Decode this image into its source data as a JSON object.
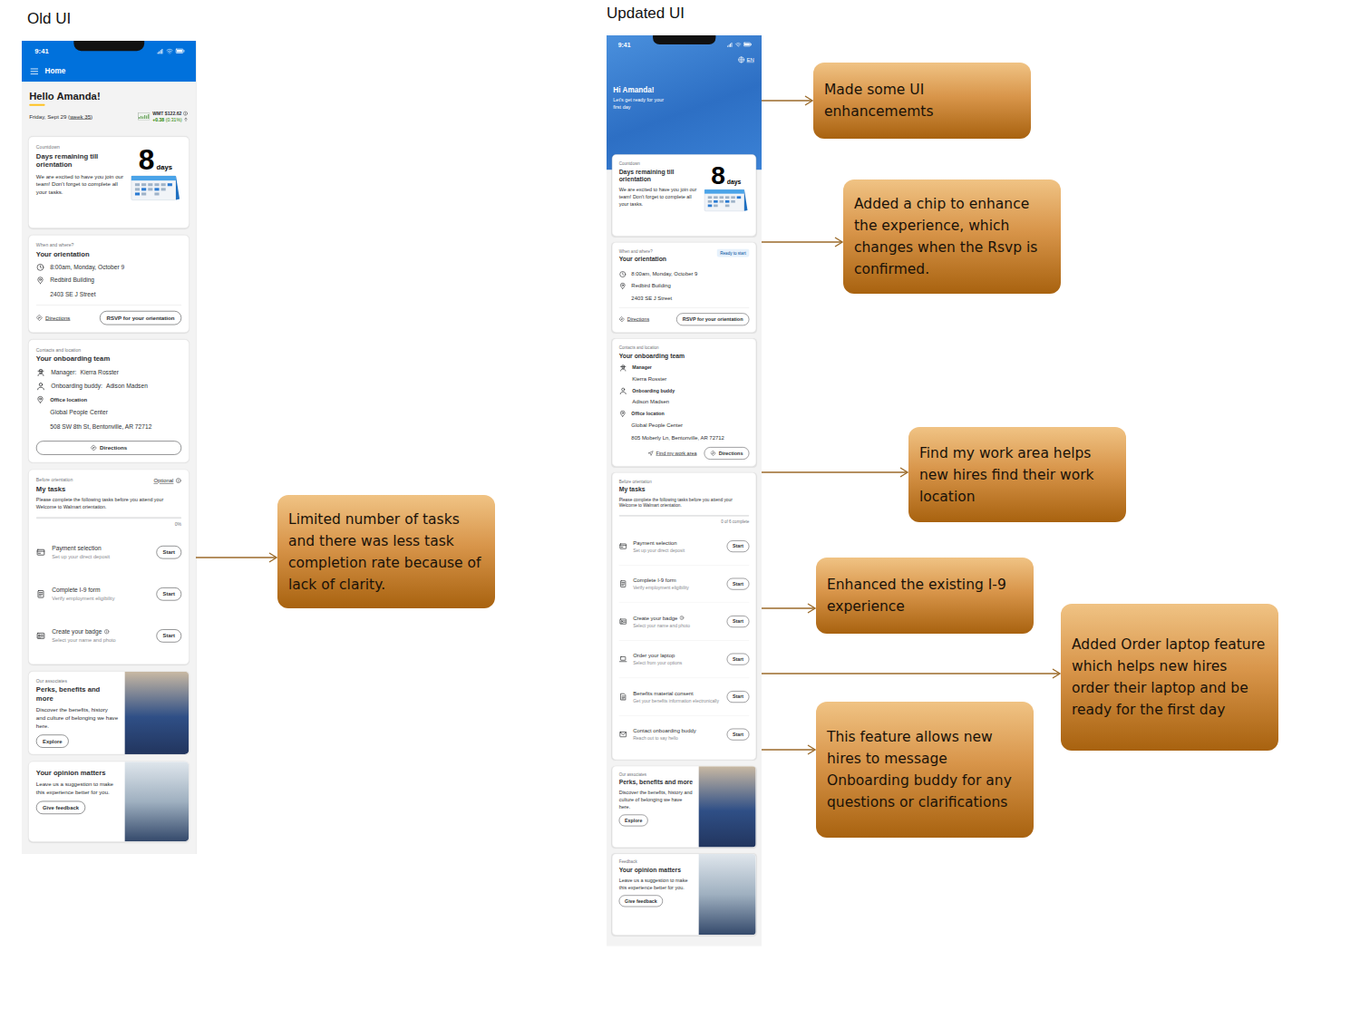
{
  "labels": {
    "old": "Old UI",
    "updated": "Updated UI"
  },
  "old_ui": {
    "status_time": "9:41",
    "header_title": "Home",
    "greeting": "Hello Amanda!",
    "date_prefix": "Friday, Sept 29 (",
    "date_week": "week 35",
    "date_suffix": ")",
    "stock": {
      "ticker": "WMT $122.62",
      "change": "+0.38",
      "percent": "(0.31%)"
    },
    "countdown": {
      "eyebrow": "Countdown",
      "title": "Days remaining till orientation",
      "body": "We are excited to have you join our team! Don't forget to complete all your tasks.",
      "number": "8",
      "unit": "days"
    },
    "orientation": {
      "eyebrow": "When and where?",
      "title": "Your orientation",
      "time": "8:00am, Monday, October 9",
      "place": [
        "Redbird Building",
        "2403 SE J Street"
      ],
      "directions": "Directions",
      "rsvp": "RSVP for your orientation"
    },
    "team": {
      "eyebrow": "Contacts and location",
      "title": "Your onboarding team",
      "members": [
        {
          "role": "Manager:",
          "name": "Kierra Rosster"
        },
        {
          "role": "Onboarding buddy:",
          "name": "Adison Madsen"
        }
      ],
      "office": {
        "label": "Office location",
        "lines": [
          "Global People Center",
          "508 SW 8th St, Bentonville, AR 72712"
        ]
      },
      "directions": "Directions"
    },
    "tasks": {
      "eyebrow": "Before orientation",
      "optional": "Optional",
      "title": "My tasks",
      "body": "Please complete the following tasks before you attend your Welcome to Walmart orientation.",
      "progress": "0%",
      "level": 0,
      "items": [
        {
          "title": "Payment selection",
          "subtitle": "Set up your direct deposit",
          "action": "Start",
          "info": false
        },
        {
          "title": "Complete I-9 form",
          "subtitle": "Verify employment eligibility",
          "action": "Start",
          "info": false
        },
        {
          "title": "Create your badge",
          "subtitle": "Select your name and photo",
          "action": "Start",
          "info": true
        }
      ]
    },
    "promos": [
      {
        "eyebrow": "Our associates",
        "title": "Perks, benefits and more",
        "body": "Discover the benefits, history and culture of belonging we have here.",
        "button": "Explore"
      },
      {
        "title": "Your opinion matters",
        "body": "Leave us a suggestion to make this experience better for you.",
        "button": "Give feedback"
      }
    ]
  },
  "updated_ui": {
    "status_time": "9:41",
    "language": "EN",
    "greeting": "Hi Amanda!",
    "subtitle": "Let's get ready for your first day",
    "countdown": {
      "eyebrow": "Countdown",
      "title": "Days remaining till orientation",
      "body": "We are excited to have you join our team! Don't forget to complete all your tasks.",
      "number": "8",
      "unit": "days"
    },
    "orientation": {
      "eyebrow": "When and where?",
      "title": "Your orientation",
      "chip": {
        "label": "Ready to start",
        "confirmed": false
      },
      "time": "8:00am, Monday, October 9",
      "place": [
        "Redbird Building",
        "2403 SE J Street"
      ],
      "directions": "Directions",
      "rsvp": "RSVP for your orientation"
    },
    "team": {
      "eyebrow": "Contacts and location",
      "title": "Your onboarding team",
      "members": [
        {
          "role": "Manager",
          "name": "Kierra Rosster"
        },
        {
          "role": "Onboarding buddy",
          "name": "Adison Madsen"
        }
      ],
      "office": {
        "label": "Office location",
        "lines": [
          "Global People Center",
          "805 Moberly Ln, Bentonville, AR 72712"
        ]
      },
      "work_area": "Find my work area",
      "directions": "Directions"
    },
    "tasks": {
      "eyebrow": "Before orientation",
      "title": "My tasks",
      "body": "Please complete the following tasks before you attend your Welcome to Walmart orientation.",
      "progress": "0 of 6 complete",
      "level": 0,
      "items": [
        {
          "title": "Payment selection",
          "subtitle": "Set up your direct deposit",
          "action": "Start",
          "info": false
        },
        {
          "title": "Complete I-9 form",
          "subtitle": "Verify employment eligibility",
          "action": "Start",
          "info": false
        },
        {
          "title": "Create your badge",
          "subtitle": "Select your name and photo",
          "action": "Start",
          "info": true
        },
        {
          "title": "Order your laptop",
          "subtitle": "Select from your options",
          "action": "Start",
          "info": false
        },
        {
          "title": "Benefits material consent",
          "subtitle": "Get your benefits information electronically",
          "action": "Start",
          "info": false
        },
        {
          "title": "Contact onboarding buddy",
          "subtitle": "Reach out to say hello",
          "action": "Start",
          "info": false
        }
      ]
    },
    "promos": [
      {
        "eyebrow": "Our associates",
        "title": "Perks, benefits and more",
        "body": "Discover the benefits, history and culture of belonging we have here.",
        "button": "Explore"
      },
      {
        "eyebrow": "Feedback",
        "title": "Your opinion matters",
        "body": "Leave us a suggestion to make this experience better for you.",
        "button": "Give feedback"
      }
    ]
  },
  "callouts": [
    {
      "text": "Limited number of tasks and there was less task completion rate because of lack of clarity."
    },
    {
      "text": "Made some UI enhancememts"
    },
    {
      "text": "Added a chip to enhance the experience, which changes when the Rsvp is confirmed."
    },
    {
      "text": "Find my work area helps new hires find their work location"
    },
    {
      "text": "Enhanced the existing I-9 experience"
    },
    {
      "text": "Added Order laptop feature which helps new hires order their laptop and be ready for the first day"
    },
    {
      "text": "This feature allows new hires to message Onboarding buddy for any questions or clarifications"
    }
  ]
}
